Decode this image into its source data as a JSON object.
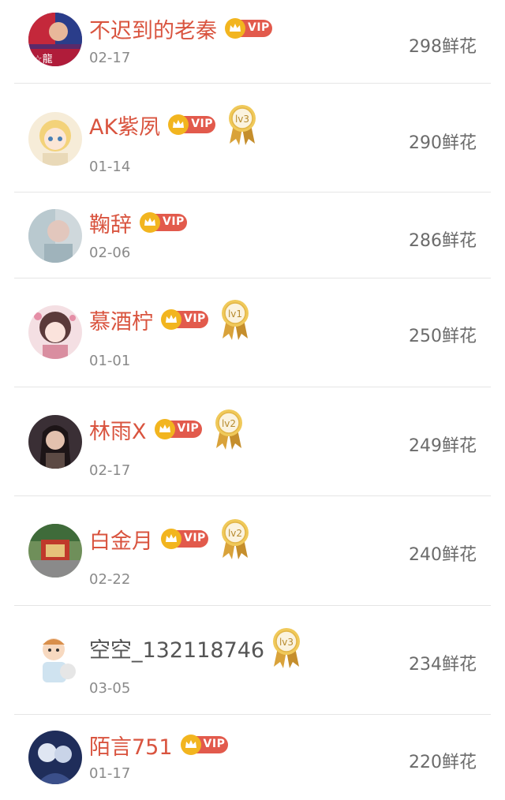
{
  "vip_label": "VIP",
  "unit_suffix": "鲜花",
  "colors": {
    "name_vip": "#d9543f",
    "name_plain": "#555555",
    "vip_badge": "#e25a4c",
    "crown_gold": "#f2b51f",
    "medal_gold": "#e7b53c",
    "divider": "#e5e5e5",
    "date": "#8a8a8a"
  },
  "rows": [
    {
      "name": "不迟到的老秦",
      "vip": true,
      "level": null,
      "date": "02-17",
      "amount": "298鲜花"
    },
    {
      "name": "AK紫夙",
      "vip": true,
      "level": "lv3",
      "date": "01-14",
      "amount": "290鲜花"
    },
    {
      "name": "鞠辞",
      "vip": true,
      "level": null,
      "date": "02-06",
      "amount": "286鲜花"
    },
    {
      "name": "慕酒柠",
      "vip": true,
      "level": "lv1",
      "date": "01-01",
      "amount": "250鲜花"
    },
    {
      "name": "林雨X",
      "vip": true,
      "level": "lv2",
      "date": "02-17",
      "amount": "249鲜花"
    },
    {
      "name": "白金月",
      "vip": true,
      "level": "lv2",
      "date": "02-22",
      "amount": "240鲜花"
    },
    {
      "name": "空空_132118746",
      "vip": false,
      "level": "lv3",
      "date": "03-05",
      "amount": "234鲜花"
    },
    {
      "name": "陌言751",
      "vip": true,
      "level": null,
      "date": "01-17",
      "amount": "220鲜花"
    }
  ]
}
